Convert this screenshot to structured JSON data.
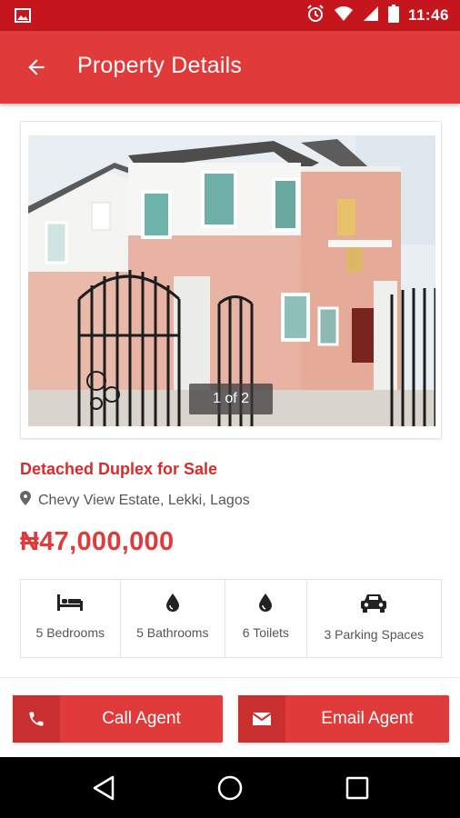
{
  "status_bar": {
    "time": "11:46",
    "icons": [
      "image-icon",
      "alarm-icon",
      "wifi-icon",
      "signal-icon",
      "battery-icon"
    ]
  },
  "app_bar": {
    "title": "Property Details",
    "back_icon": "arrow-back-icon"
  },
  "gallery": {
    "counter": "1 of 2"
  },
  "property": {
    "title": "Detached Duplex for Sale",
    "location": "Chevy View Estate, Lekki, Lagos",
    "price": "₦47,000,000"
  },
  "features": [
    {
      "icon": "bed-icon",
      "label": "5 Bedrooms"
    },
    {
      "icon": "water-drop-icon",
      "label": "5 Bathrooms"
    },
    {
      "icon": "water-drop-icon",
      "label": "6 Toilets"
    },
    {
      "icon": "car-icon",
      "label": "3 Parking Spaces"
    }
  ],
  "actions": {
    "call_label": "Call Agent",
    "email_label": "Email Agent"
  },
  "colors": {
    "status_bar": "#c4161c",
    "app_bar": "#e03a3a",
    "accent": "#d92b2b",
    "button_icon_bg": "#c92f2f"
  }
}
